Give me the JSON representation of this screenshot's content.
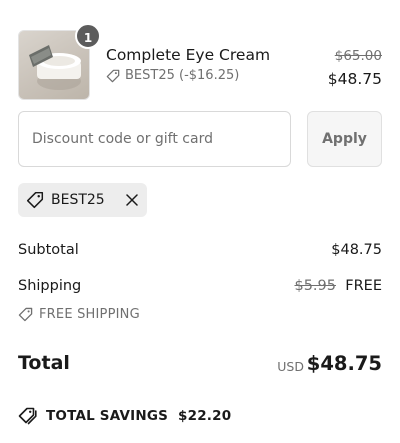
{
  "line_item": {
    "quantity": "1",
    "name": "Complete Eye Cream",
    "discount_label": "BEST25 (-$16.25)",
    "original_price": "$65.00",
    "final_price": "$48.75",
    "image_icon": "eye-cream-jar-image"
  },
  "discount": {
    "placeholder": "Discount code or gift card",
    "value": "",
    "apply_label": "Apply"
  },
  "applied_code": {
    "code": "BEST25",
    "tag_icon": "tag-icon",
    "remove_icon": "close-icon"
  },
  "summary": {
    "subtotal_label": "Subtotal",
    "subtotal_value": "$48.75",
    "shipping_label": "Shipping",
    "shipping_original": "$5.95",
    "shipping_value": "FREE",
    "shipping_note": "FREE SHIPPING"
  },
  "total": {
    "label": "Total",
    "currency": "USD",
    "amount": "$48.75"
  },
  "savings": {
    "label": "TOTAL SAVINGS",
    "amount": "$22.20"
  },
  "colors": {
    "text": "#1a1a1a",
    "muted": "#707070",
    "badge": "#5c5c5c",
    "tag_bg": "#ededed",
    "button_bg": "#f6f6f6",
    "border": "#d9d9d9"
  }
}
